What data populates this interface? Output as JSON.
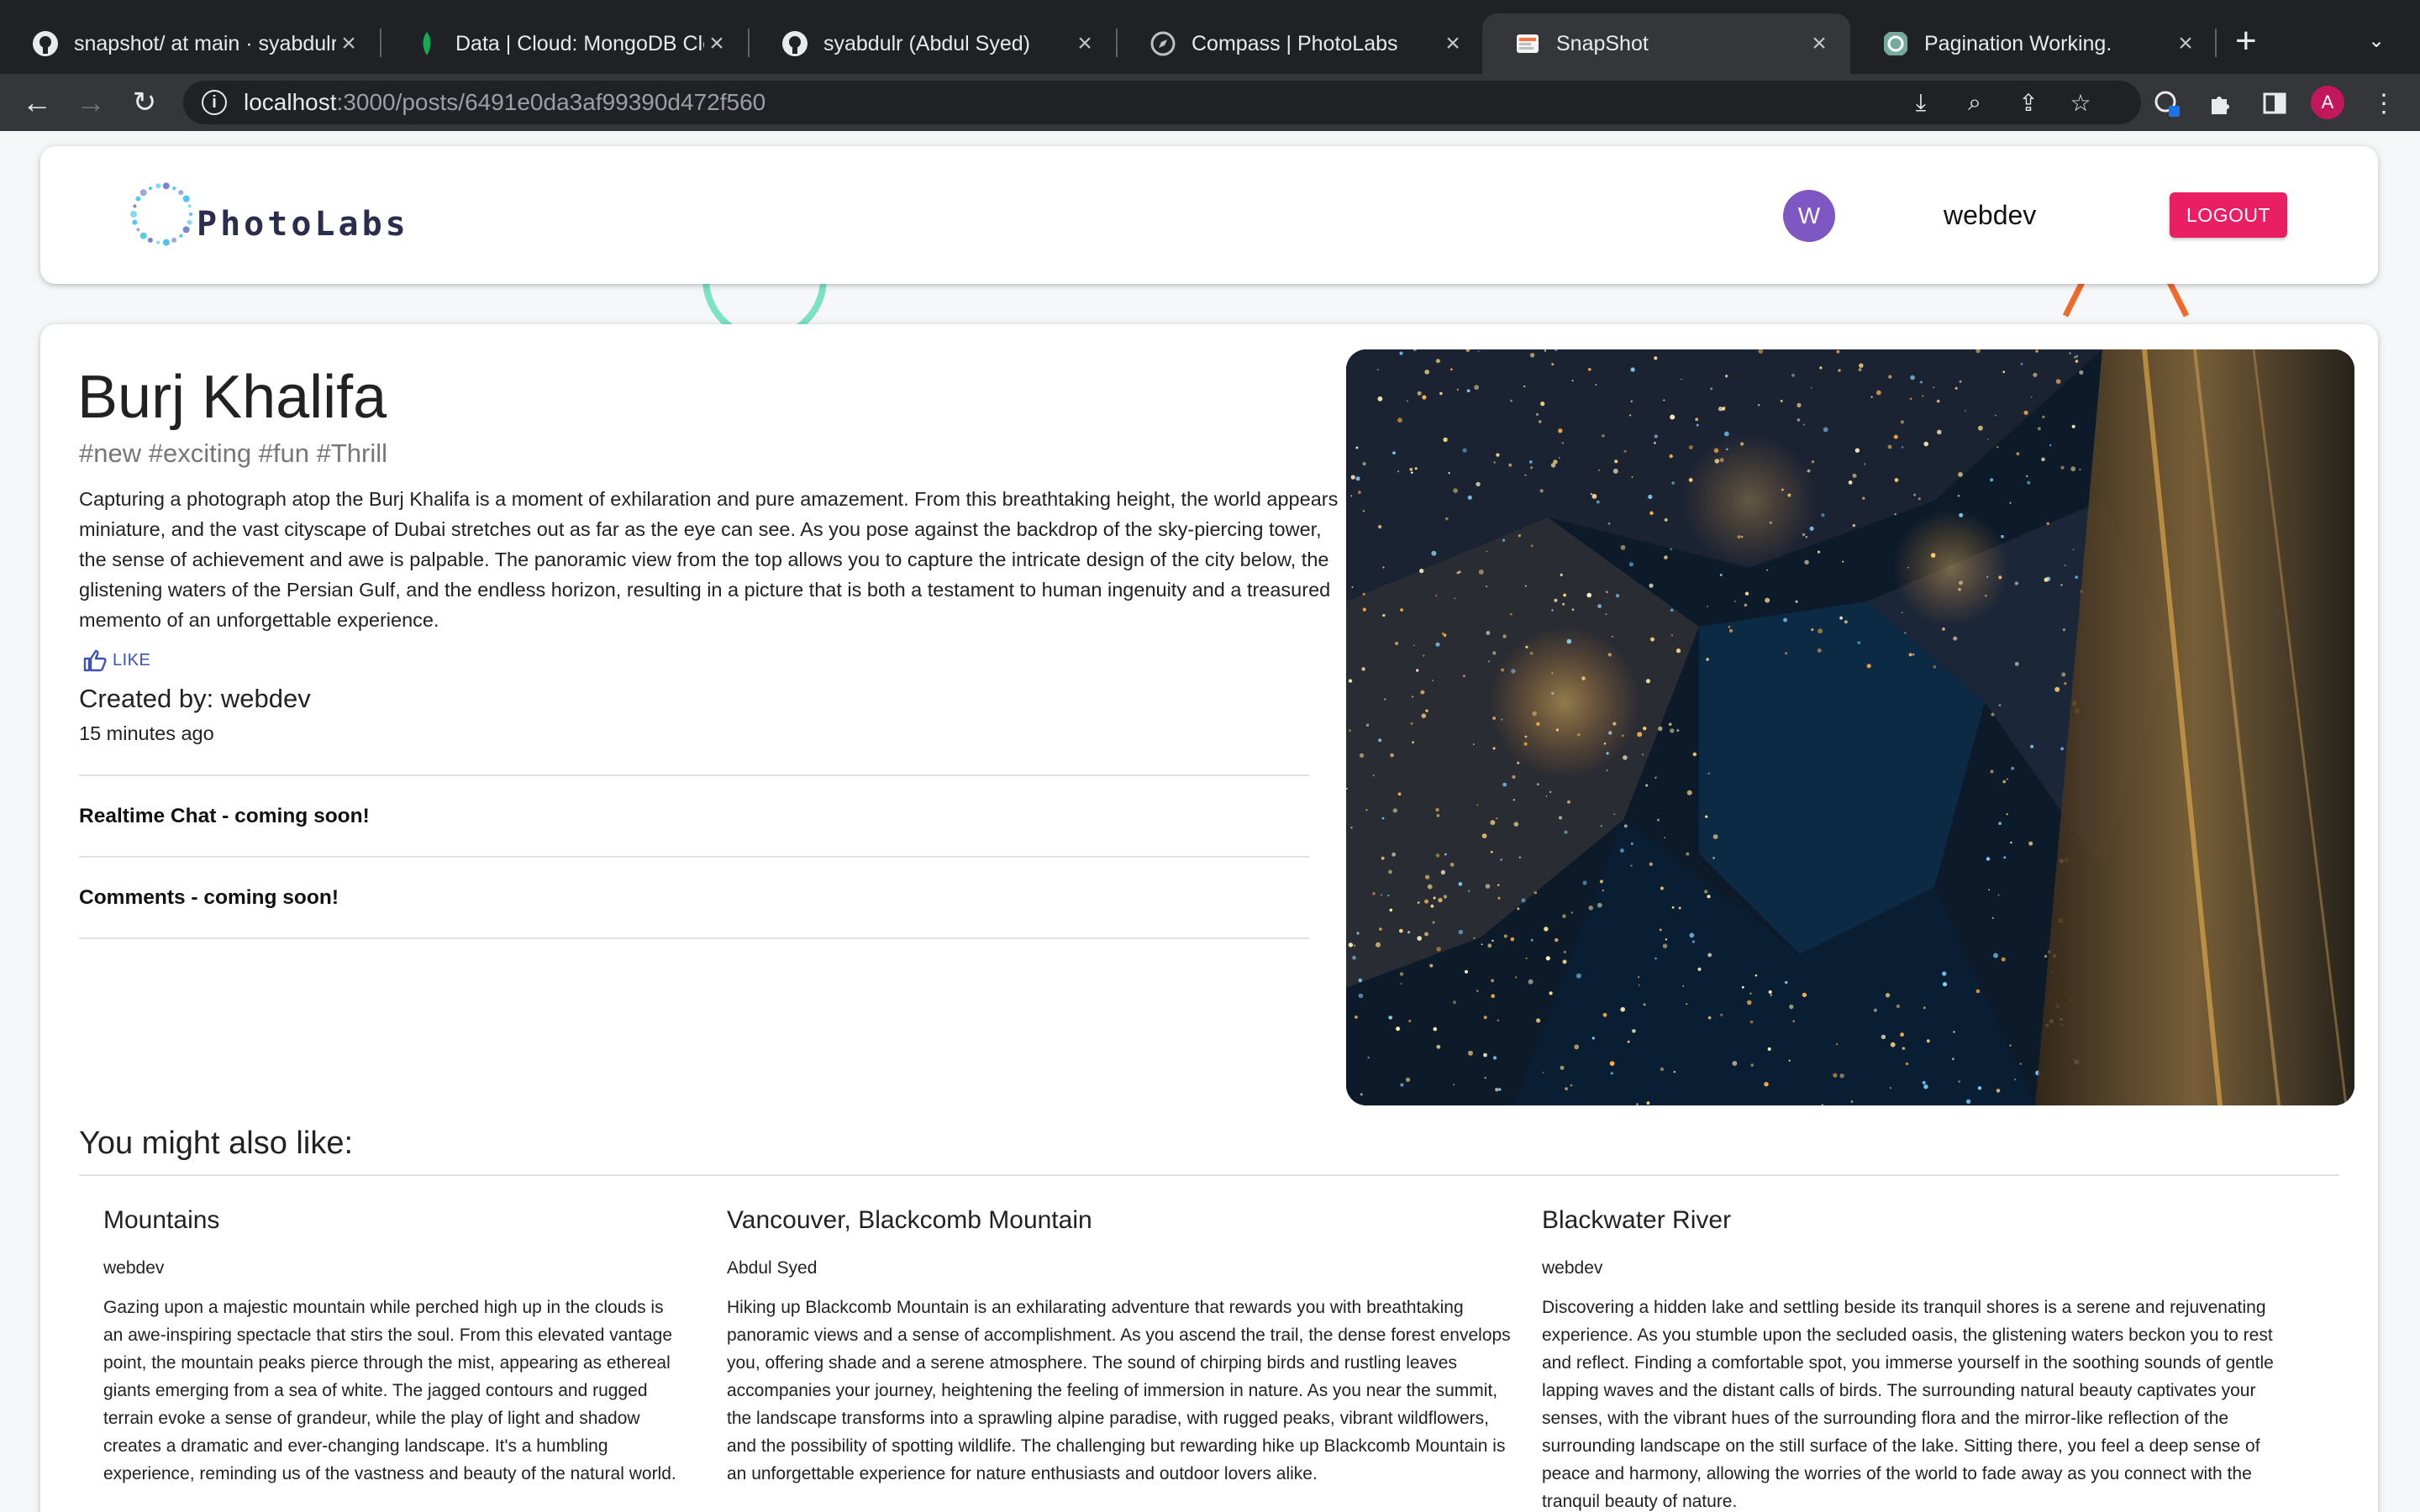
{
  "browser": {
    "tabs": [
      {
        "title": "snapshot/ at main · syabdulr",
        "favicon": "github-icon"
      },
      {
        "title": "Data | Cloud: MongoDB Cloud",
        "favicon": "mongodb-leaf-icon"
      },
      {
        "title": "syabdulr (Abdul Syed)",
        "favicon": "github-icon"
      },
      {
        "title": "Compass | PhotoLabs",
        "favicon": "compass-icon"
      },
      {
        "title": "SnapShot",
        "favicon": "snapshot-icon",
        "active": true
      },
      {
        "title": "Pagination Working.",
        "favicon": "chatgpt-icon"
      }
    ],
    "url_host": "localhost",
    "url_rest": ":3000/posts/6491e0da3af99390d472f560",
    "profile_initial": "A"
  },
  "app": {
    "brand": "PhotoLabs",
    "user_initial": "W",
    "username": "webdev",
    "logout_label": "LOGOUT"
  },
  "post": {
    "title": "Burj Khalifa",
    "tags": "#new #exciting #fun #Thrill",
    "message": "Capturing a photograph atop the Burj Khalifa is a moment of exhilaration and pure amazement. From this breathtaking height, the world appears miniature, and the vast cityscape of Dubai stretches out as far as the eye can see. As you pose against the backdrop of the sky-piercing tower, the sense of achievement and awe is palpable. The panoramic view from the top allows you to capture the intricate design of the city below, the glistening waters of the Persian Gulf, and the endless horizon, resulting in a picture that is both a testament to human ingenuity and a treasured memento of an unforgettable experience.",
    "like_label": "LIKE",
    "created_by": "Created by: webdev",
    "created_time": "15 minutes ago",
    "chat_note": "Realtime Chat - coming soon!",
    "comments_note": "Comments - coming soon!"
  },
  "recommended": {
    "heading": "You might also like:",
    "items": [
      {
        "title": "Mountains",
        "author": "webdev",
        "message": "Gazing upon a majestic mountain while perched high up in the clouds is an awe-inspiring spectacle that stirs the soul. From this elevated vantage point, the mountain peaks pierce through the mist, appearing as ethereal giants emerging from a sea of white. The jagged contours and rugged terrain evoke a sense of grandeur, while the play of light and shadow creates a dramatic and ever-changing landscape. It's a humbling experience, reminding us of the vastness and beauty of the natural world."
      },
      {
        "title": "Vancouver, Blackcomb Mountain",
        "author": "Abdul Syed",
        "message": "Hiking up Blackcomb Mountain is an exhilarating adventure that rewards you with breathtaking panoramic views and a sense of accomplishment. As you ascend the trail, the dense forest envelops you, offering shade and a serene atmosphere. The sound of chirping birds and rustling leaves accompanies your journey, heightening the feeling of immersion in nature. As you near the summit, the landscape transforms into a sprawling alpine paradise, with rugged peaks, vibrant wildflowers, and the possibility of spotting wildlife. The challenging but rewarding hike up Blackcomb Mountain is an unforgettable experience for nature enthusiasts and outdoor lovers alike."
      },
      {
        "title": "Blackwater River",
        "author": "webdev",
        "message": "Discovering a hidden lake and settling beside its tranquil shores is a serene and rejuvenating experience. As you stumble upon the secluded oasis, the glistening waters beckon you to rest and reflect. Finding a comfortable spot, you immerse yourself in the soothing sounds of gentle lapping waves and the distant calls of birds. The surrounding natural beauty captivates your senses, with the vibrant hues of the surrounding flora and the mirror-like reflection of the surrounding landscape on the still surface of the lake. Sitting there, you feel a deep sense of peace and harmony, allowing the worries of the world to fade away as you connect with the tranquil beauty of nature."
      }
    ]
  },
  "colors": {
    "accent": "#e91e63",
    "avatar": "#7e57c2",
    "like": "#3f51b5",
    "brand_text": "#2b2d4e"
  }
}
